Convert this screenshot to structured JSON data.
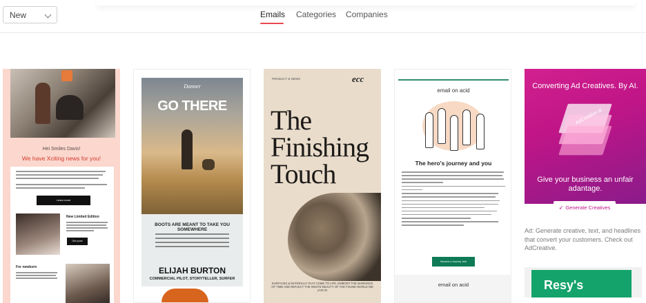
{
  "toolbar": {
    "sort_value": "New",
    "tabs": [
      {
        "label": "Emails",
        "active": true
      },
      {
        "label": "Categories",
        "active": false
      },
      {
        "label": "Companies",
        "active": false
      }
    ],
    "accent_color": "#e5484d"
  },
  "cards": [
    {
      "greeting": "Hei Smiles Davis!",
      "headline": "We have Xciting news for you!",
      "button": "Learn more",
      "section_title": "New Limited Edition",
      "section_button": "Get yours",
      "section_title_2": "For newborn"
    },
    {
      "brand": "Danner",
      "headline": "GO THERE",
      "tagline": "BOOTS ARE MEANT TO TAKE YOU SOMEWHERE",
      "name": "ELIJAH BURTON",
      "role": "COMMERCIAL PILOT, STORYTELLER, SURFER"
    },
    {
      "label": "PRODUCT & NEWS",
      "brand": "ecc",
      "title": "The Finishing Touch",
      "footer": "SURFACES & MATERIALS THAT COME TO LIFE, EMBODY THE MARKINGS OF TIME AND REFLECT THE INNATE BEAUTY OF THE FOUND WORLD WE LIVE IN"
    },
    {
      "brand": "email on acid",
      "headline": "The hero's journey and you",
      "cta": "Become a Journey Jedi",
      "footer_brand": "email on acid"
    },
    {
      "ad_title": "Converting Ad Creatives. By AI.",
      "stack_label": "AdCreative.ai",
      "ad_subtitle": "Give your business an unfair adantage.",
      "ad_button": "Generate Creatives",
      "ad_copy": "Ad: Generate creative, text, and headlines that convert your customers. Check out AdCreative.",
      "next_card_label": "Resy's"
    }
  ]
}
